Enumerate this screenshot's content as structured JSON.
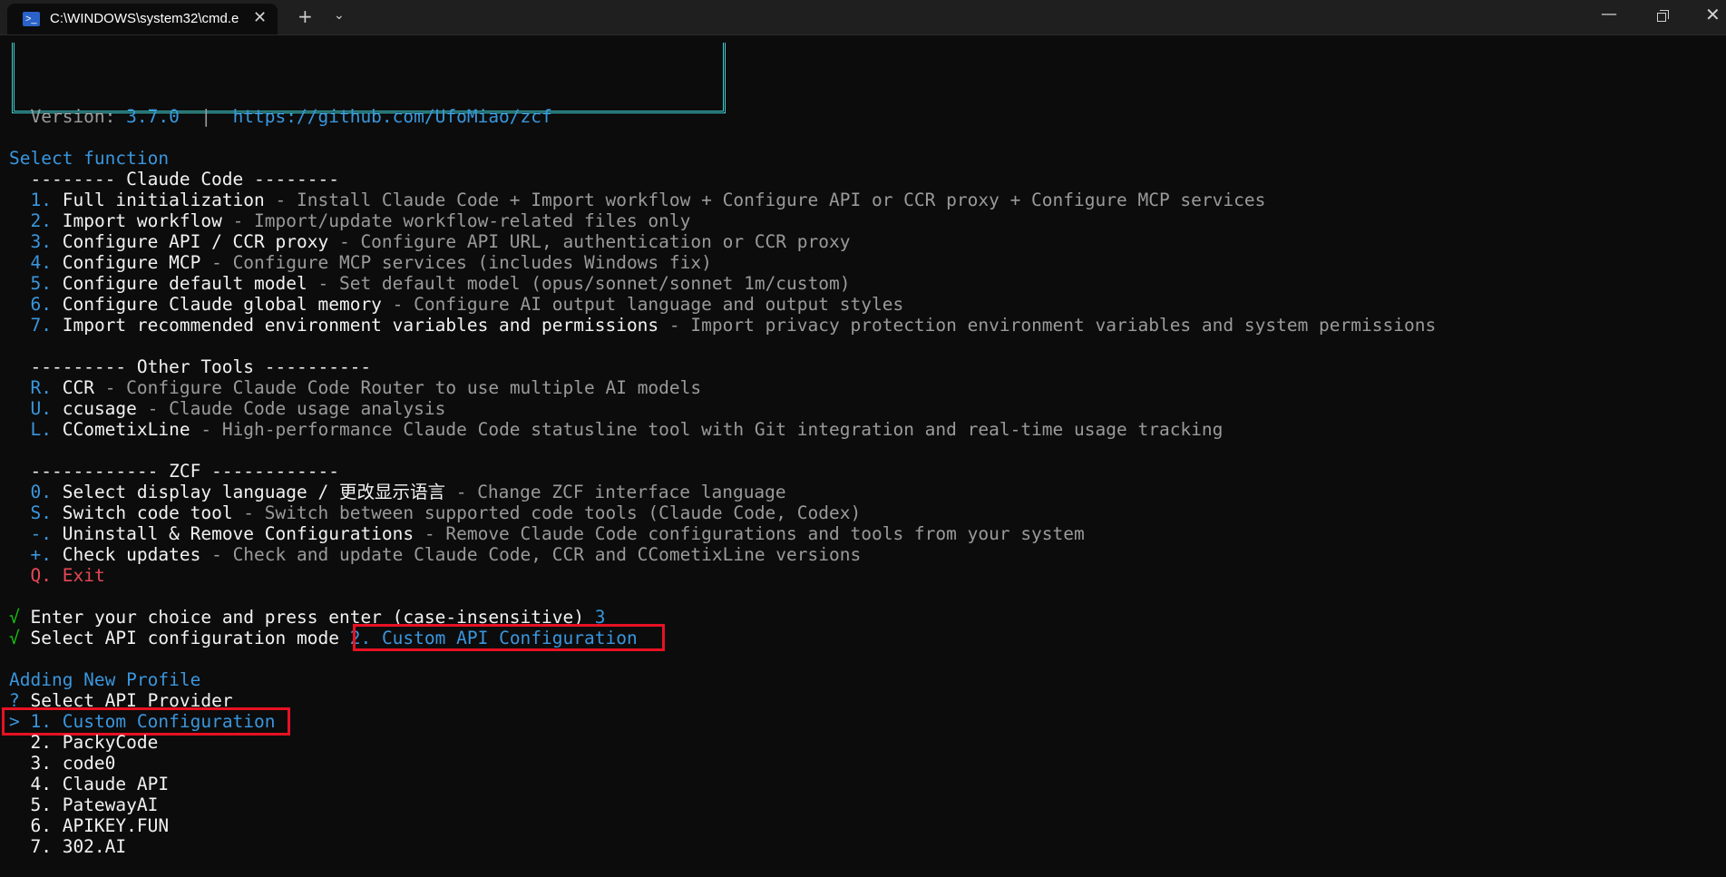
{
  "window": {
    "tab_title": "C:\\WINDOWS\\system32\\cmd.e",
    "tab_icon": "powershell-icon",
    "close_glyph": "✕",
    "new_tab_glyph": "+",
    "dropdown_glyph": "⌄",
    "minimize_glyph": "—",
    "close_window_glyph": "✕"
  },
  "header": {
    "version_label": "Version: ",
    "version": "3.7.0",
    "separator": "  |  ",
    "url": "https://github.com/UfoMiao/zcf"
  },
  "menu": {
    "title": "Select function",
    "sections": [
      {
        "heading": "  -------- Claude Code --------",
        "items": [
          {
            "key": "1.",
            "label": "Full initialization",
            "desc": " - Install Claude Code + Import workflow + Configure API or CCR proxy + Configure MCP services"
          },
          {
            "key": "2.",
            "label": "Import workflow",
            "desc": " - Import/update workflow-related files only"
          },
          {
            "key": "3.",
            "label": "Configure API / CCR proxy",
            "desc": " - Configure API URL, authentication or CCR proxy"
          },
          {
            "key": "4.",
            "label": "Configure MCP",
            "desc": " - Configure MCP services (includes Windows fix)"
          },
          {
            "key": "5.",
            "label": "Configure default model",
            "desc": " - Set default model (opus/sonnet/sonnet 1m/custom)"
          },
          {
            "key": "6.",
            "label": "Configure Claude global memory",
            "desc": " - Configure AI output language and output styles"
          },
          {
            "key": "7.",
            "label": "Import recommended environment variables and permissions",
            "desc": " - Import privacy protection environment variables and system permissions"
          }
        ]
      },
      {
        "heading": "  --------- Other Tools ----------",
        "items": [
          {
            "key": "R.",
            "label": "CCR",
            "desc": " - Configure Claude Code Router to use multiple AI models"
          },
          {
            "key": "U.",
            "label": "ccusage",
            "desc": " - Claude Code usage analysis"
          },
          {
            "key": "L.",
            "label": "CCometixLine",
            "desc": " - High-performance Claude Code statusline tool with Git integration and real-time usage tracking"
          }
        ]
      },
      {
        "heading": "  ------------ ZCF ------------",
        "items": [
          {
            "key": "0.",
            "label": "Select display language / 更改显示语言",
            "desc": " - Change ZCF interface language"
          },
          {
            "key": "S.",
            "label": "Switch code tool",
            "desc": " - Switch between supported code tools (Claude Code, Codex)"
          },
          {
            "key": "-.",
            "label": "Uninstall & Remove Configurations",
            "desc": " - Remove Claude Code configurations and tools from your system"
          },
          {
            "key": "+.",
            "label": "Check updates",
            "desc": " - Check and update Claude Code, CCR and CCometixLine versions"
          }
        ]
      }
    ],
    "exit": {
      "key": "Q.",
      "label": "Exit"
    }
  },
  "prompts": {
    "check_glyph": "√",
    "choice_prompt": "Enter your choice and press enter (case-insensitive)",
    "choice_value": "3",
    "mode_prompt": "Select API configuration mode",
    "mode_value": "2. Custom API Configuration"
  },
  "provider": {
    "title": "Adding New Profile",
    "question_glyph": "?",
    "question": "Select API Provider",
    "cursor": ">",
    "options": [
      "1. Custom Configuration",
      "2. PackyCode",
      "3. code0",
      "4. Claude API",
      "5. PatewayAI",
      "6. APIKEY.FUN",
      "7. 302.AI"
    ]
  },
  "colors": {
    "background": "#0c0c0c",
    "accent_blue": "#3a96dd",
    "frame_cyan": "#41d1d1",
    "highlight_red": "#e81123"
  }
}
